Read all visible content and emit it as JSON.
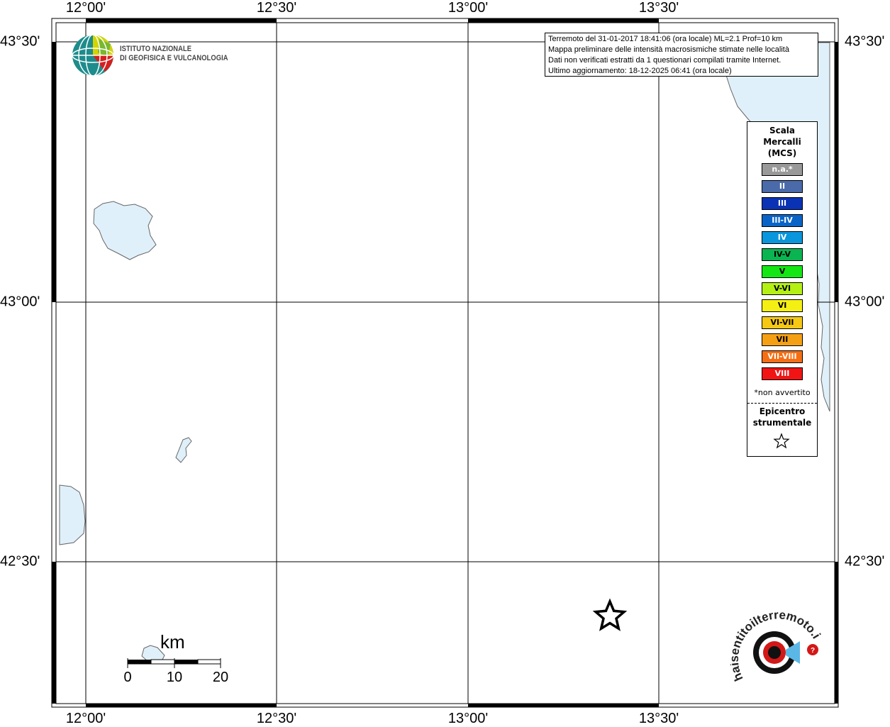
{
  "map": {
    "lon_labels": [
      "12°00'",
      "12°30'",
      "13°00'",
      "13°30'"
    ],
    "lat_labels": [
      "43°30'",
      "43°00'",
      "42°30'"
    ]
  },
  "info": {
    "line1": "Terremoto del 31-01-2017 18:41:06 (ora locale) ML=2.1 Prof=10 km",
    "line2": "Mappa preliminare delle intensità macrosismiche stimate nelle località",
    "line3": "Dati non verificati estratti da 1 questionari compilati tramite Internet.",
    "line4": "Ultimo aggiornamento: 18-12-2025 06:41 (ora locale)"
  },
  "logo": {
    "line1": "ISTITUTO NAZIONALE",
    "line2": "DI GEOFISICA E VULCANOLOGIA"
  },
  "legend": {
    "title1": "Scala",
    "title2": "Mercalli",
    "title3": "(MCS)",
    "items": [
      {
        "label": "n.a.*",
        "color": "#999999"
      },
      {
        "label": "II",
        "color": "#4a6aaa"
      },
      {
        "label": "III",
        "color": "#0a32b4"
      },
      {
        "label": "III-IV",
        "color": "#0a64c8"
      },
      {
        "label": "IV",
        "color": "#0a96dc"
      },
      {
        "label": "IV-V",
        "color": "#0ab450"
      },
      {
        "label": "V",
        "color": "#14e614"
      },
      {
        "label": "V-VI",
        "color": "#b4f014"
      },
      {
        "label": "VI",
        "color": "#f5f014"
      },
      {
        "label": "VI-VII",
        "color": "#f5c814"
      },
      {
        "label": "VII",
        "color": "#f5a014"
      },
      {
        "label": "VII-VIII",
        "color": "#f56e14"
      },
      {
        "label": "VIII",
        "color": "#f01414"
      }
    ],
    "note": "*non avvertito",
    "epicenter1": "Epicentro",
    "epicenter2": "strumentale"
  },
  "scale": {
    "unit": "km",
    "ticks": [
      "0",
      "10",
      "20"
    ]
  },
  "colors": {
    "water": "#e0f0fa",
    "frame": "#000000"
  }
}
